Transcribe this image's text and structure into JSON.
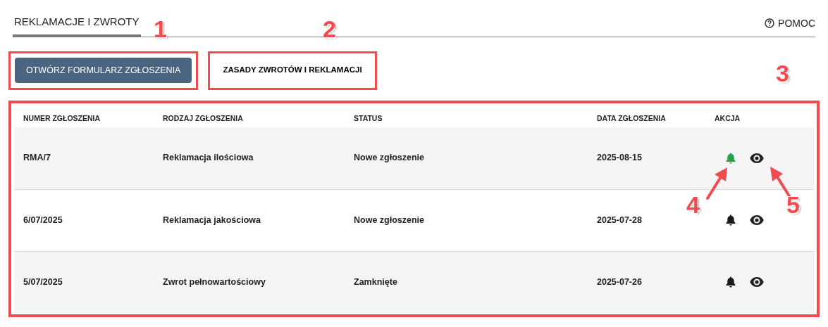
{
  "header": {
    "tab": {
      "label": "REKLAMACJE I ZWROTY",
      "selected": true
    },
    "help": "POMOC"
  },
  "actions": [
    {
      "kind": "primary",
      "label": "OTWÓRZ FORMULARZ ZGŁOSZENIA"
    },
    {
      "kind": "link",
      "label": "ZASADY ZWROTÓW I REKLAMACJI"
    }
  ],
  "table": {
    "columns": [
      "NUMER ZGŁOSZENIA",
      "RODZAJ ZGŁOSZENIA",
      "STATUS",
      "DATA ZGŁOSZENIA",
      "AKCJA"
    ],
    "rows": [
      {
        "number": "RMA/7",
        "type": "Reklamacja ilościowa",
        "status": "Nowe zgłoszenie",
        "date": "2025-08-15",
        "notification_active": true
      },
      {
        "number": "6/07/2025",
        "type": "Reklamacja jakościowa",
        "status": "Nowe zgłoszenie",
        "date": "2025-07-28",
        "notification_active": false
      },
      {
        "number": "5/07/2025",
        "type": "Zwrot pełnowartościowy",
        "status": "Zamknięte",
        "date": "2025-07-26",
        "notification_active": false
      }
    ]
  },
  "annotations": [
    {
      "label": "1"
    },
    {
      "label": "2"
    },
    {
      "label": "3"
    },
    {
      "label": "4"
    },
    {
      "label": "5"
    }
  ]
}
